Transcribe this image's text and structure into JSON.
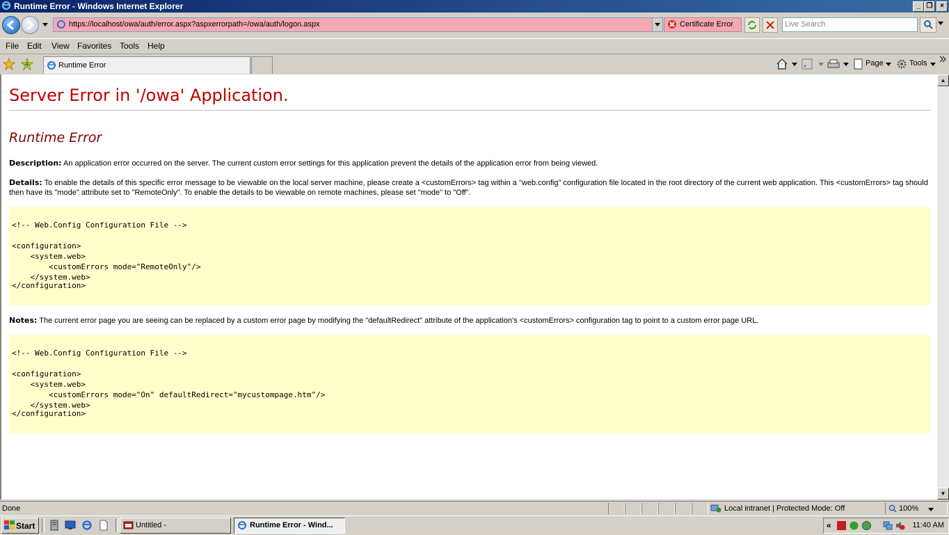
{
  "window": {
    "title": "Runtime Error - Windows Internet Explorer",
    "minimize": "_",
    "maximize": "❐",
    "close": "×"
  },
  "address": {
    "url": "https://localhost/owa/auth/error.aspx?aspxerrorpath=/owa/auth/logon.aspx",
    "cert_label": "Certificate Error",
    "search_placeholder": "Live Search"
  },
  "menu": [
    "File",
    "Edit",
    "View",
    "Favorites",
    "Tools",
    "Help"
  ],
  "tab": {
    "label": "Runtime Error"
  },
  "toolbar": {
    "page": "Page",
    "tools": "Tools"
  },
  "page": {
    "heading": "Server Error in '/owa' Application.",
    "subheading": "Runtime Error",
    "description_label": "Description:",
    "description": " An application error occurred on the server. The current custom error settings for this application prevent the details of the application error from being viewed.",
    "details_label": "Details:",
    "details": " To enable the details of this specific error message to be viewable on the local server machine, please create a <customErrors> tag within a \"web.config\" configuration file located in the root directory of the current web application. This <customErrors> tag should then have its \"mode\" attribute set to \"RemoteOnly\". To enable the details to be viewable on remote machines, please set \"mode\" to \"Off\".",
    "code1": [
      "<!-- Web.Config Configuration File -->",
      "",
      "<configuration>",
      "    <system.web>",
      "        <customErrors mode=\"RemoteOnly\"/>",
      "    </system.web>",
      "</configuration>"
    ],
    "notes_label": "Notes:",
    "notes": " The current error page you are seeing can be replaced by a custom error page by modifying the \"defaultRedirect\" attribute of the application's <customErrors> configuration tag to point to a custom error page URL.",
    "code2": [
      "<!-- Web.Config Configuration File -->",
      "",
      "<configuration>",
      "    <system.web>",
      "        <customErrors mode=\"On\" defaultRedirect=\"mycustompage.htm\"/>",
      "    </system.web>",
      "</configuration>"
    ]
  },
  "status": {
    "text": "Done",
    "zone": "Local intranet | Protected Mode: Off",
    "zoom": "100%"
  },
  "taskbar": {
    "start": "Start",
    "task1": "Untitled -",
    "task2": "Runtime Error - Wind...",
    "clock": "11:40 AM"
  }
}
